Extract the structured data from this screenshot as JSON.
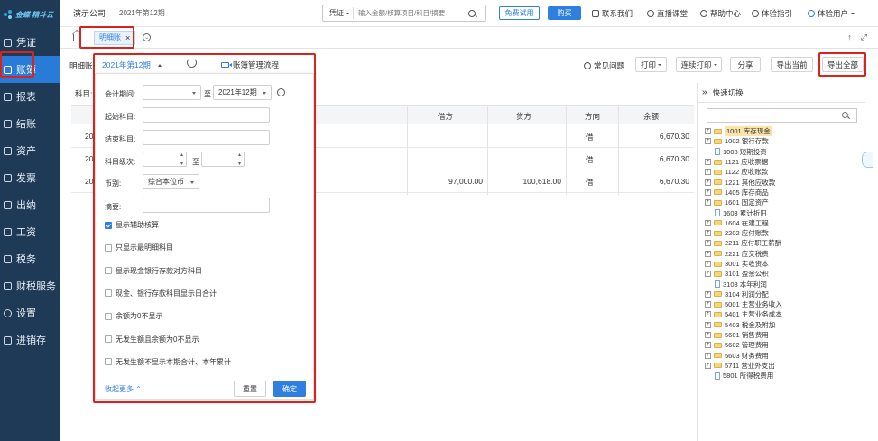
{
  "brand": {
    "logo_text": "金蝶 精斗云",
    "accent": "#2f7fe0",
    "sidebar_bg": "#1f3a57",
    "highlight": "#d9231c"
  },
  "sidebar": {
    "items": [
      {
        "label": "凭证",
        "icon": "voucher-icon"
      },
      {
        "label": "账簿",
        "icon": "ledger-icon",
        "active": true
      },
      {
        "label": "报表",
        "icon": "report-icon"
      },
      {
        "label": "结账",
        "icon": "close-period-icon"
      },
      {
        "label": "资产",
        "icon": "asset-icon"
      },
      {
        "label": "发票",
        "icon": "invoice-icon"
      },
      {
        "label": "出纳",
        "icon": "cashier-icon"
      },
      {
        "label": "工资",
        "icon": "salary-icon"
      },
      {
        "label": "税务",
        "icon": "tax-icon"
      },
      {
        "label": "财税服务",
        "icon": "service-icon"
      },
      {
        "label": "设置",
        "icon": "settings-icon"
      },
      {
        "label": "进销存",
        "icon": "inventory-icon"
      }
    ]
  },
  "header": {
    "company": "演示公司",
    "period": "2021年第12期",
    "search_type": "凭证",
    "search_placeholder": "输入金额/核算项目/科目/摘要",
    "trial_label": "免费试用",
    "buy_label": "购买",
    "links": [
      "联系我们",
      "直播课堂",
      "帮助中心",
      "体验指引"
    ],
    "user": "体验用户"
  },
  "tabs": {
    "active_label": "明细账",
    "close": "×"
  },
  "toolbar": {
    "label": "明细账:",
    "period": "2021年第12期",
    "flow_label": "账簿管理流程",
    "faq": "常见问题",
    "print": "打印",
    "continuous_print": "连续打印",
    "share": "分享",
    "export_current": "导出当前",
    "export_all": "导出全部"
  },
  "table": {
    "subject_label": "科目:",
    "headers": {
      "debit": "借方",
      "credit": "贷方",
      "direction": "方向",
      "balance": "余额"
    },
    "rows": [
      {
        "prefix": "20",
        "debit": "",
        "credit": "",
        "direction": "借",
        "balance": "6,670.30"
      },
      {
        "prefix": "20",
        "debit": "",
        "credit": "",
        "direction": "借",
        "balance": "6,670.30"
      },
      {
        "prefix": "20",
        "debit": "97,000.00",
        "credit": "100,618.00",
        "direction": "借",
        "balance": "6,670.30"
      }
    ]
  },
  "quick_switch": {
    "title": "快速切换",
    "items": [
      {
        "code": "1001 库存现金",
        "type": "folder",
        "selected": true
      },
      {
        "code": "1002 银行存款",
        "type": "folder"
      },
      {
        "code": "1003 短期投资",
        "type": "file"
      },
      {
        "code": "1121 应收票据",
        "type": "folder"
      },
      {
        "code": "1122 应收账款",
        "type": "folder"
      },
      {
        "code": "1221 其他应收款",
        "type": "folder"
      },
      {
        "code": "1405 库存商品",
        "type": "folder"
      },
      {
        "code": "1601 固定资产",
        "type": "folder"
      },
      {
        "code": "1603 累计折旧",
        "type": "file"
      },
      {
        "code": "1604 在建工程",
        "type": "folder"
      },
      {
        "code": "2202 应付账款",
        "type": "folder"
      },
      {
        "code": "2211 应付职工薪酬",
        "type": "folder"
      },
      {
        "code": "2221 应交税费",
        "type": "folder"
      },
      {
        "code": "3001 实收资本",
        "type": "folder"
      },
      {
        "code": "3101 盈余公积",
        "type": "folder"
      },
      {
        "code": "3103 本年利润",
        "type": "file"
      },
      {
        "code": "3104 利润分配",
        "type": "folder"
      },
      {
        "code": "5001 主营业务收入",
        "type": "folder"
      },
      {
        "code": "5401 主营业务成本",
        "type": "folder"
      },
      {
        "code": "5403 税金及附加",
        "type": "folder"
      },
      {
        "code": "5601 销售费用",
        "type": "folder"
      },
      {
        "code": "5602 管理费用",
        "type": "folder"
      },
      {
        "code": "5603 财务费用",
        "type": "folder"
      },
      {
        "code": "5711 营业外支出",
        "type": "folder"
      },
      {
        "code": "5801 所得税费用",
        "type": "file"
      }
    ]
  },
  "filter": {
    "period_label": "会计期间:",
    "period_from": "",
    "to": "至",
    "period_to": "2021年12期",
    "start_subject_label": "起始科目:",
    "end_subject_label": "结束科目:",
    "level_label": "科目级次:",
    "currency_label": "币别:",
    "currency_value": "综合本位币",
    "summary_label": "摘要:",
    "options": [
      {
        "label": "显示辅助核算",
        "checked": true
      },
      {
        "label": "只显示最明细科目",
        "checked": false
      },
      {
        "label": "显示现金银行存款对方科目",
        "checked": false
      },
      {
        "label": "现金、银行存款科目显示日合计",
        "checked": false
      },
      {
        "label": "余额为0不显示",
        "checked": false
      },
      {
        "label": "无发生额且余额为0不显示",
        "checked": false
      },
      {
        "label": "无发生额不显示本期合计、本年累计",
        "checked": false
      }
    ],
    "collapse_link": "收起更多",
    "reset": "重置",
    "confirm": "确定"
  }
}
